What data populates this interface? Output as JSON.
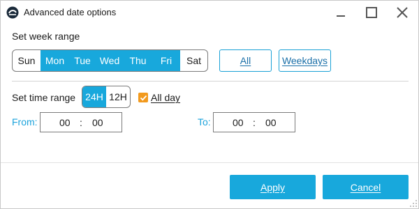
{
  "window": {
    "title": "Advanced date options",
    "controls": [
      "minimize-icon",
      "maximize-icon",
      "close-icon"
    ]
  },
  "week": {
    "label": "Set week range",
    "days": [
      {
        "label": "Sun",
        "selected": false
      },
      {
        "label": "Mon",
        "selected": true
      },
      {
        "label": "Tue",
        "selected": true
      },
      {
        "label": "Wed",
        "selected": true
      },
      {
        "label": "Thu",
        "selected": true
      },
      {
        "label": "Fri",
        "selected": true
      },
      {
        "label": "Sat",
        "selected": false
      }
    ],
    "all_label": "All",
    "weekdays_label": "Weekdays"
  },
  "time": {
    "label": "Set time range",
    "format_options": [
      {
        "label": "24H",
        "selected": true
      },
      {
        "label": "12H",
        "selected": false
      }
    ],
    "all_day_label": "All day",
    "all_day_checked": true,
    "from_label": "From:",
    "from_hour": "00",
    "from_minute": "00",
    "to_label": "To:",
    "to_hour": "00",
    "to_minute": "00",
    "separator": ":"
  },
  "footer": {
    "apply_label": "Apply",
    "cancel_label": "Cancel"
  },
  "colors": {
    "accent": "#18a8dc",
    "checkbox": "#f29a1e"
  }
}
